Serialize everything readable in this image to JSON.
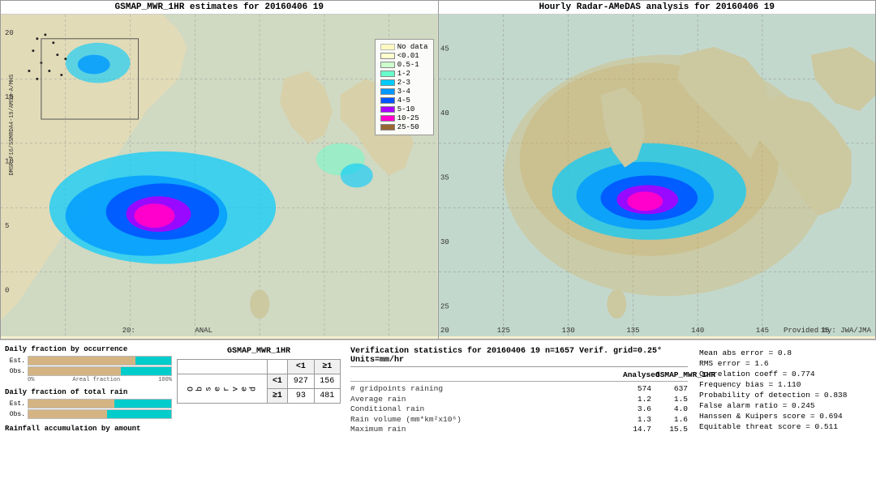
{
  "left_map": {
    "title": "GSMAP_MWR_1HR estimates for 20160406 19",
    "attribution_vertical": "DMSP-F16/SSMRDA4-19/AMSU-A/MHS",
    "label_anal": "20: ANAL"
  },
  "right_map": {
    "title": "Hourly Radar-AMeDAS analysis for 20160406 19",
    "attribution": "Provided by: JWA/JMA"
  },
  "legend": {
    "title": "No data",
    "items": [
      {
        "label": "<0.01",
        "color": "#ffffd0"
      },
      {
        "label": "0.5-1",
        "color": "#ccffcc"
      },
      {
        "label": "1-2",
        "color": "#66ffcc"
      },
      {
        "label": "2-3",
        "color": "#00ccff"
      },
      {
        "label": "3-4",
        "color": "#0099ff"
      },
      {
        "label": "4-5",
        "color": "#0055ff"
      },
      {
        "label": "5-10",
        "color": "#aa00ff"
      },
      {
        "label": "10-25",
        "color": "#ff00cc"
      },
      {
        "label": "25-50",
        "color": "#996633"
      }
    ]
  },
  "charts": {
    "occurrence_title": "Daily fraction by occurrence",
    "rain_title": "Daily fraction of total rain",
    "accumulation_label": "Rainfall accumulation by amount",
    "est_label": "Est.",
    "obs_label": "Obs.",
    "axis_start": "0%",
    "axis_mid": "Areal fraction",
    "axis_end": "100%"
  },
  "contingency": {
    "title": "GSMAP_MWR_1HR",
    "col_lt1": "<1",
    "col_ge1": "≥1",
    "row_lt1": "<1",
    "row_ge1": "≥1",
    "observed_label": "O\nb\ns\ne\nr\nv\ne\nd",
    "val_lt1_lt1": "927",
    "val_lt1_ge1": "156",
    "val_ge1_lt1": "93",
    "val_ge1_ge1": "481"
  },
  "stats": {
    "title": "Verification statistics for 20160406 19  n=1657  Verif. grid=0.25°  Units=mm/hr",
    "header_analysed": "Analysed",
    "header_gsmap": "GSMAP_MWR_1HR",
    "rows": [
      {
        "name": "# gridpoints raining",
        "analysed": "574",
        "gsmap": "637"
      },
      {
        "name": "Average rain",
        "analysed": "1.2",
        "gsmap": "1.5"
      },
      {
        "name": "Conditional rain",
        "analysed": "3.6",
        "gsmap": "4.0"
      },
      {
        "name": "Rain volume (mm*km²x10⁶)",
        "analysed": "1.3",
        "gsmap": "1.6"
      },
      {
        "name": "Maximum rain",
        "analysed": "14.7",
        "gsmap": "15.5"
      }
    ]
  },
  "right_stats": {
    "mean_abs_error": "Mean abs error = 0.8",
    "rms_error": "RMS error = 1.6",
    "correlation": "Correlation coeff = 0.774",
    "freq_bias": "Frequency bias = 1.110",
    "prob_detection": "Probability of detection = 0.838",
    "false_alarm": "False alarm ratio = 0.245",
    "hanssen": "Hanssen & Kuipers score = 0.694",
    "equitable": "Equitable threat score = 0.511"
  }
}
